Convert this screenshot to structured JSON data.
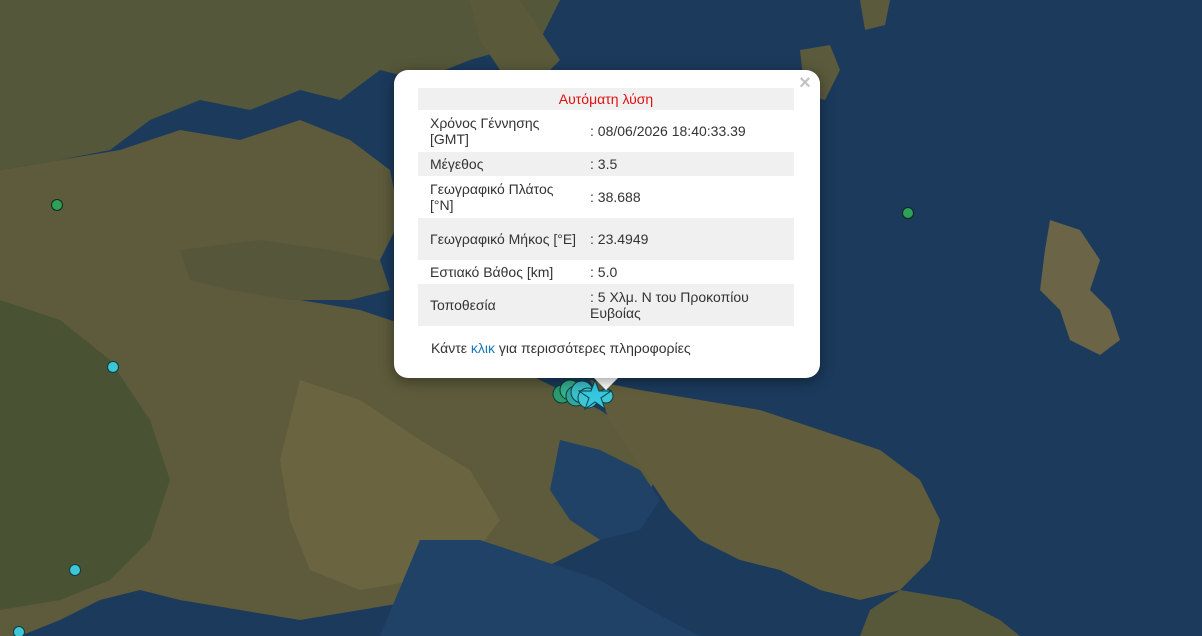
{
  "popup": {
    "header": "Αυτόματη λύση",
    "close_symbol": "×",
    "rows": [
      {
        "label": "Χρόνος Γέννησης [GMT]",
        "value": ": 08/06/2026 18:40:33.39"
      },
      {
        "label": "Μέγεθος",
        "value": ": 3.5"
      },
      {
        "label": "Γεωγραφικό Πλάτος [°N]",
        "value": ": 38.688"
      },
      {
        "label": "Γεωγραφικό Μήκος [°E]",
        "value": ": 23.4949"
      },
      {
        "label": "Εστιακό Βάθος [km]",
        "value": ": 5.0"
      },
      {
        "label": "Τοποθεσία",
        "value": ": 5 Χλμ. Ν του Προκοπίου Ευβοίας"
      }
    ],
    "footer_before": "Κάντε ",
    "footer_link": "κλικ",
    "footer_after": " για περισσότερες πληροφορίες"
  },
  "colors": {
    "sea": "#1b3a5c",
    "land": "#5b5a3a",
    "marker_green": "#2da05a",
    "marker_cyan": "#3ec6d4",
    "star": "#35c8e0",
    "header_text": "#e01010",
    "link": "#1877b5"
  },
  "markers": [
    {
      "color": "green"
    },
    {
      "color": "green"
    },
    {
      "color": "cyan"
    },
    {
      "color": "cyan"
    },
    {
      "color": "cyan"
    }
  ],
  "event_icon": "star-icon"
}
